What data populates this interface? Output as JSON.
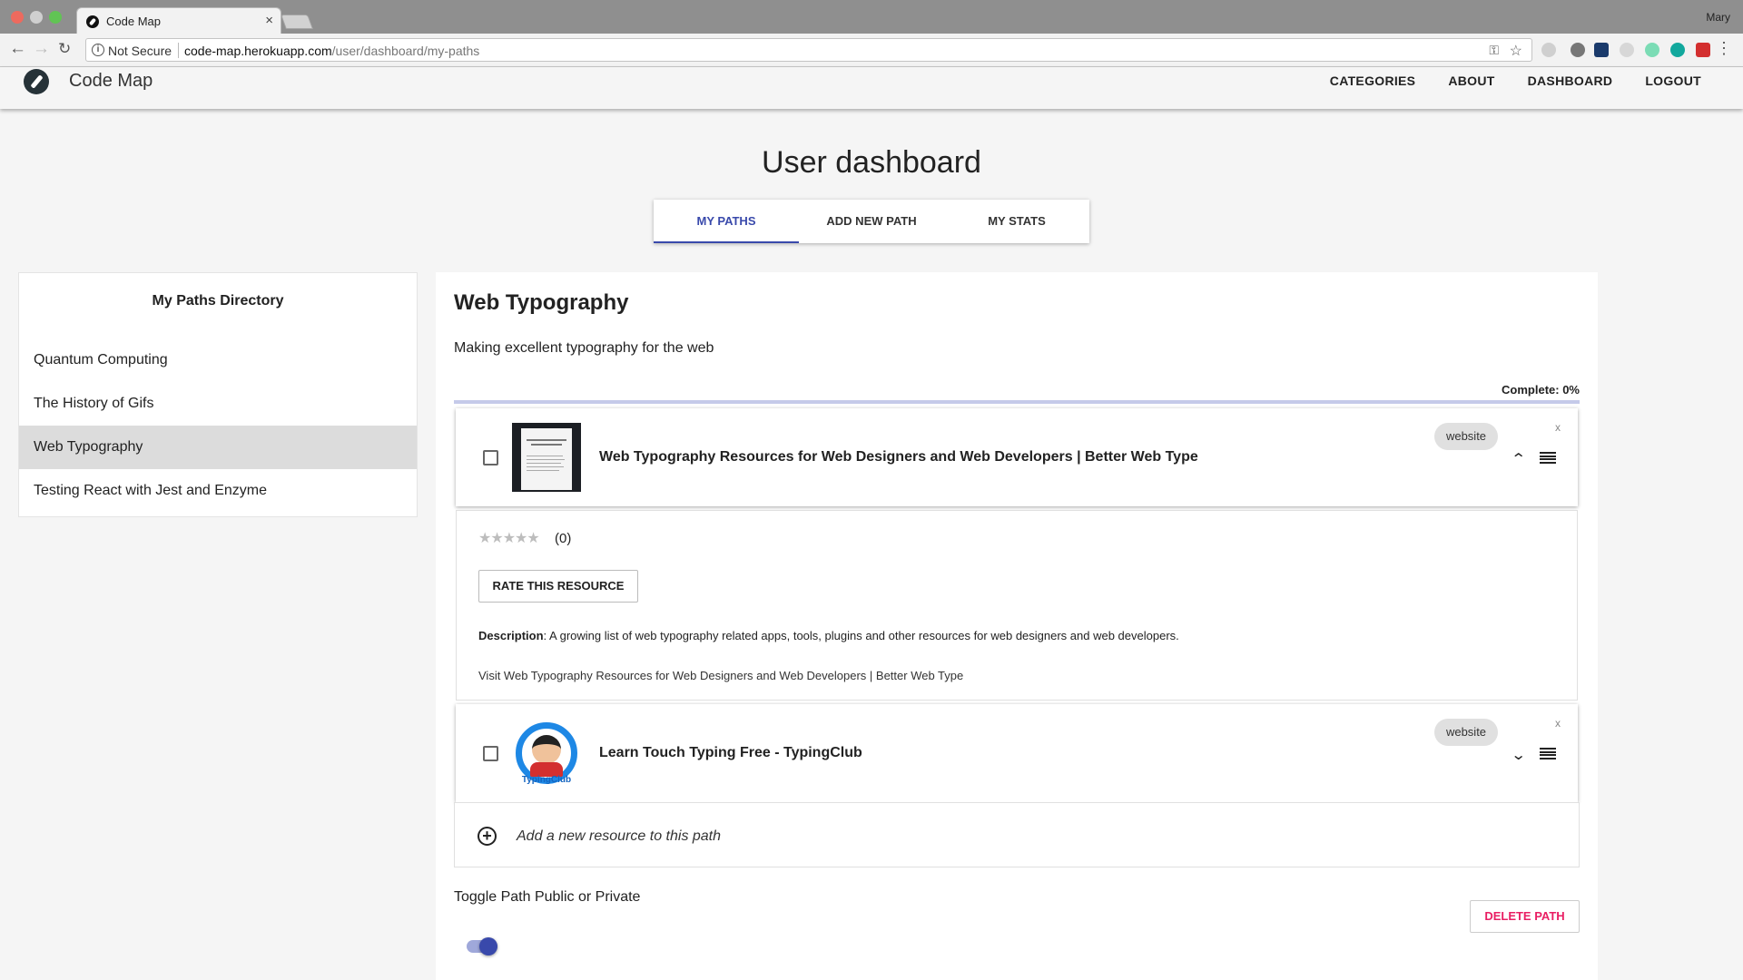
{
  "browser": {
    "tab_title": "Code Map",
    "tab_close": "×",
    "profile_name": "Mary",
    "security_label": "Not Secure",
    "url_host": "code-map.herokuapp.com",
    "url_path": "/user/dashboard/my-paths"
  },
  "header": {
    "brand": "Code Map",
    "nav": [
      "CATEGORIES",
      "ABOUT",
      "DASHBOARD",
      "LOGOUT"
    ]
  },
  "page": {
    "title": "User dashboard",
    "tabs": [
      {
        "label": "MY PATHS",
        "active": true
      },
      {
        "label": "ADD NEW PATH",
        "active": false
      },
      {
        "label": "MY STATS",
        "active": false
      }
    ]
  },
  "sidebar": {
    "title": "My Paths Directory",
    "items": [
      {
        "label": "Quantum Computing"
      },
      {
        "label": "The History of Gifs"
      },
      {
        "label": "Web Typography",
        "active": true
      },
      {
        "label": "Testing React with Jest and Enzyme"
      }
    ]
  },
  "path": {
    "title": "Web Typography",
    "description": "Making excellent typography for the web",
    "complete_label": "Complete: 0%",
    "progress": 0,
    "resources": [
      {
        "title": "Web Typography Resources for Web Designers and Web Developers | Better Web Type",
        "type": "website",
        "remove": "x",
        "chevron": "up-chevron-icon",
        "thumbnail_text": "BETTER WEB TYPOGRAPHY FOR A BETTER WEB"
      },
      {
        "title": "Learn Touch Typing Free - TypingClub",
        "type": "website",
        "remove": "x",
        "chevron": "down-chevron-icon",
        "thumbnail_text": "TypingClub"
      }
    ],
    "expanded": {
      "stars": "★★★★★",
      "rating_count": "(0)",
      "rate_button": "RATE THIS RESOURCE",
      "description_label": "Description",
      "description_text": ": A growing list of web typography related apps, tools, plugins and other resources for web designers and web developers.",
      "visit_text": "Visit Web Typography Resources for Web Designers and Web Developers | Better Web Type"
    },
    "add_resource_placeholder": "Add a new resource to this path",
    "toggle_label": "Toggle Path Public or Private",
    "toggle_on": true,
    "delete_button": "DELETE PATH"
  },
  "colors": {
    "accent": "#3949ab",
    "danger": "#e91e63"
  }
}
